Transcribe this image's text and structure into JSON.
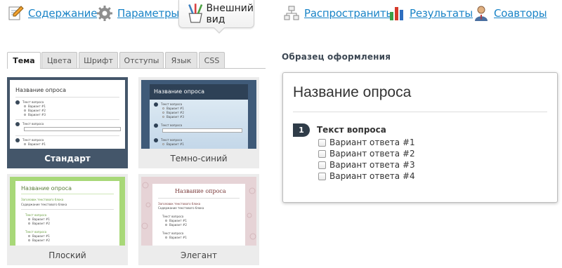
{
  "nav": {
    "items": [
      {
        "label": "Содержание",
        "icon": "pencil-edit-icon"
      },
      {
        "label": "Параметры",
        "icon": "gear-icon"
      },
      {
        "label": "Внешний вид",
        "icon": "paint-brushes-icon",
        "active": true
      },
      {
        "label": "Распространить",
        "icon": "share-tree-icon"
      },
      {
        "label": "Результаты",
        "icon": "bar-chart-icon"
      },
      {
        "label": "Соавторы",
        "icon": "users-icon"
      }
    ]
  },
  "tabs": [
    "Тема",
    "Цвета",
    "Шрифт",
    "Отступы",
    "Язык",
    "CSS"
  ],
  "themes": [
    {
      "name": "Стандарт",
      "selected": true
    },
    {
      "name": "Темно-синий"
    },
    {
      "name": "Плоский"
    },
    {
      "name": "Элегант"
    }
  ],
  "thumb_text": {
    "survey_title": "Название опроса",
    "question": "Текст вопроса",
    "option1": "Вариант #1",
    "option2": "Вариант #2",
    "option3": "Вариант #3",
    "flat_header": "Заголовок текстового блока",
    "flat_text": "Содержание текстового блока"
  },
  "preview": {
    "heading": "Образец оформления",
    "survey_title": "Название опроса",
    "question_number": "1",
    "question_text": "Текст вопроса",
    "options": [
      "Вариант ответа #1",
      "Вариант ответа #2",
      "Вариант ответа #3",
      "Вариант ответа #4"
    ]
  },
  "colors": {
    "link": "#1a84c7",
    "selected_theme_bg": "#44566a",
    "dark_blue_theme": "#3f5a78",
    "flat_theme_green": "#a8d878",
    "elegant_theme_pattern": "#e6d3d6"
  }
}
